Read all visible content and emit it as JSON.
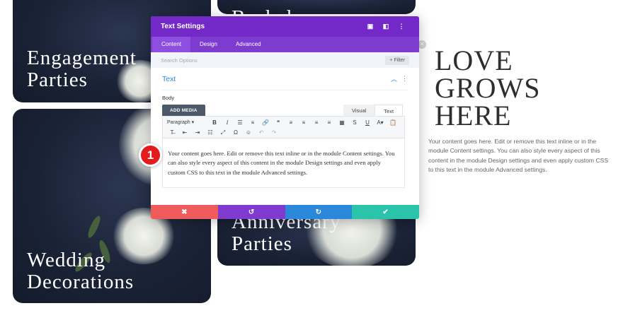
{
  "cards": {
    "engagement": "Engagement\nParties",
    "weddings": "Wedding\nDecorations",
    "top_partial": "Bachelor",
    "anniversary": "Anniversary\nParties"
  },
  "right": {
    "title": "LOVE\nGROWS\nHERE",
    "body": "Your content goes here. Edit or remove this text inline or in the module Content settings. You can also style every aspect of this content in the module Design settings and even apply custom CSS to this text in the module Advanced settings."
  },
  "modal": {
    "title": "Text Settings",
    "tabs": [
      "Content",
      "Design",
      "Advanced"
    ],
    "search_placeholder": "Search Options",
    "filter_label": "+ Filter",
    "section_label": "Text",
    "body_label": "Body",
    "add_media": "ADD MEDIA",
    "editor_tabs": [
      "Visual",
      "Text"
    ],
    "paragraph": "Paragraph",
    "content": "Your content goes here. Edit or remove this text inline or in the module Content settings. You can also style every aspect of this content in the module Design settings and even apply custom CSS to this text in the module Advanced settings.",
    "footer": [
      "✖",
      "↺",
      "↻",
      "✔"
    ]
  },
  "step_number": "1",
  "colors": {
    "header": "#7329c7",
    "tabs": "#7e3bd0",
    "link": "#2b87da",
    "cancel": "#ef5a5a",
    "undo": "#7f3ad0",
    "redo": "#2b87da",
    "save": "#29c4a9",
    "badge": "#e31b1b"
  }
}
